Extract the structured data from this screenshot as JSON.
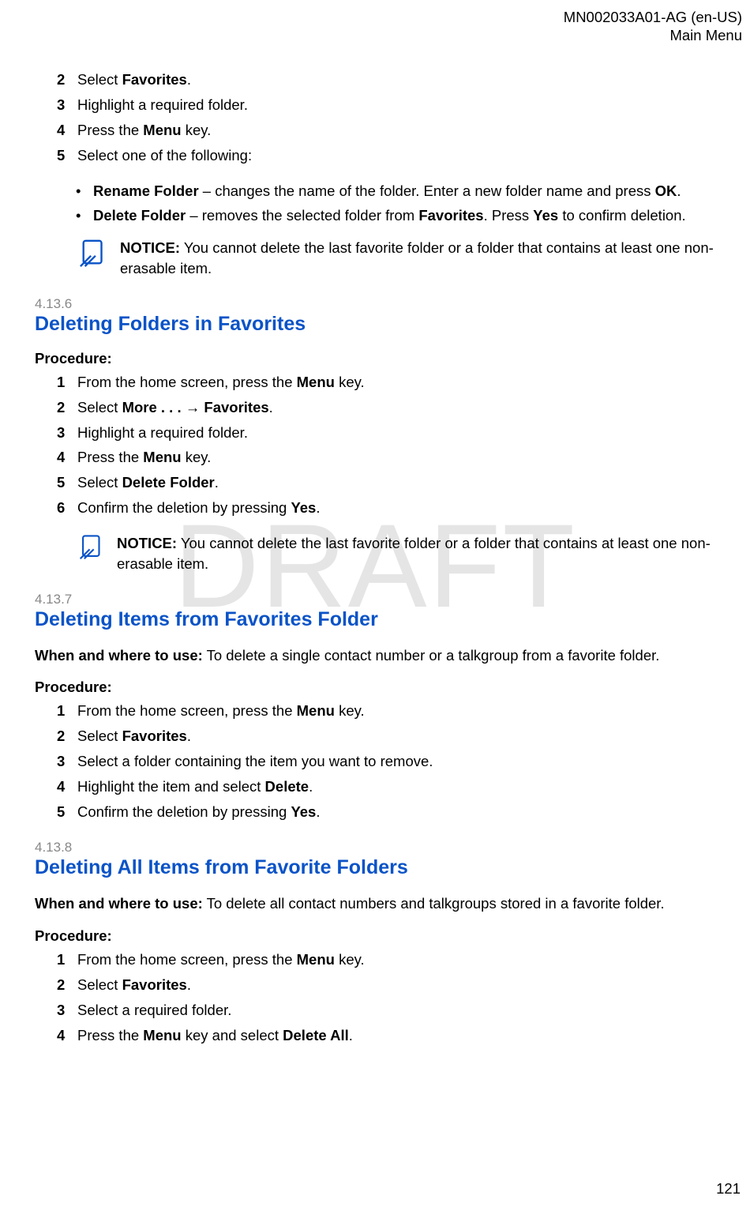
{
  "header": {
    "doc_id": "MN002033A01-AG (en-US)",
    "section": "Main Menu"
  },
  "watermark": "DRAFT",
  "page_number": "121",
  "intro_steps": [
    {
      "num": "2",
      "parts": [
        "Select ",
        "Favorites",
        "."
      ]
    },
    {
      "num": "3",
      "parts": [
        "Highlight a required folder."
      ]
    },
    {
      "num": "4",
      "parts": [
        "Press the ",
        "Menu",
        " key."
      ]
    },
    {
      "num": "5",
      "parts": [
        "Select one of the following:"
      ]
    }
  ],
  "intro_bullets": [
    [
      "",
      "Rename Folder",
      " – changes the name of the folder. Enter a new folder name and press ",
      "OK",
      "."
    ],
    [
      "",
      "Delete Folder",
      " – removes the selected folder from ",
      "Favorites",
      ". Press ",
      "Yes",
      " to confirm deletion."
    ]
  ],
  "intro_notice": [
    "NOTICE:",
    " You cannot delete the last favorite folder or a folder that contains at least one non-erasable item."
  ],
  "sections": [
    {
      "num": "4.13.6",
      "title": "Deleting Folders in Favorites",
      "procedure_label": "Procedure:",
      "steps": [
        {
          "num": "1",
          "parts": [
            "From the home screen, press the ",
            "Menu",
            " key."
          ]
        },
        {
          "num": "2",
          "parts": [
            "Select ",
            "More . . .",
            " → ",
            "Favorites",
            "."
          ]
        },
        {
          "num": "3",
          "parts": [
            "Highlight a required folder."
          ]
        },
        {
          "num": "4",
          "parts": [
            "Press the ",
            "Menu",
            " key."
          ]
        },
        {
          "num": "5",
          "parts": [
            "Select ",
            "Delete Folder",
            "."
          ]
        },
        {
          "num": "6",
          "parts": [
            "Confirm the deletion by pressing ",
            "Yes",
            "."
          ]
        }
      ],
      "notice": [
        "NOTICE:",
        " You cannot delete the last favorite folder or a folder that contains at least one non-erasable item."
      ]
    },
    {
      "num": "4.13.7",
      "title": "Deleting Items from Favorites Folder",
      "when_label": "When and where to use:",
      "when_text": " To delete a single contact number or a talkgroup from a favorite folder.",
      "procedure_label": "Procedure:",
      "steps": [
        {
          "num": "1",
          "parts": [
            "From the home screen, press the ",
            "Menu",
            " key."
          ]
        },
        {
          "num": "2",
          "parts": [
            "Select ",
            "Favorites",
            "."
          ]
        },
        {
          "num": "3",
          "parts": [
            "Select a folder containing the item you want to remove."
          ]
        },
        {
          "num": "4",
          "parts": [
            "Highlight the item and select ",
            "Delete",
            "."
          ]
        },
        {
          "num": "5",
          "parts": [
            "Confirm the deletion by pressing ",
            "Yes",
            "."
          ]
        }
      ]
    },
    {
      "num": "4.13.8",
      "title": "Deleting All Items from Favorite Folders",
      "when_label": "When and where to use:",
      "when_text": " To delete all contact numbers and talkgroups stored in a favorite folder.",
      "procedure_label": "Procedure:",
      "steps": [
        {
          "num": "1",
          "parts": [
            "From the home screen, press the ",
            "Menu",
            " key."
          ]
        },
        {
          "num": "2",
          "parts": [
            "Select ",
            "Favorites",
            "."
          ]
        },
        {
          "num": "3",
          "parts": [
            "Select a required folder."
          ]
        },
        {
          "num": "4",
          "parts": [
            "Press the ",
            "Menu",
            " key and select ",
            "Delete All",
            "."
          ]
        }
      ]
    }
  ]
}
